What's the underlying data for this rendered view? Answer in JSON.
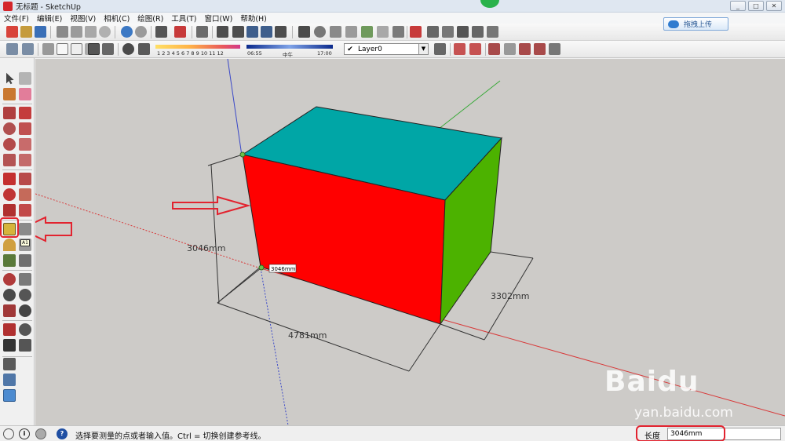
{
  "window": {
    "title": "无标题 - SketchUp",
    "controls": [
      "_",
      "□",
      "✕"
    ]
  },
  "menu": [
    "文件(F)",
    "编辑(E)",
    "视图(V)",
    "相机(C)",
    "绘图(R)",
    "工具(T)",
    "窗口(W)",
    "帮助(H)"
  ],
  "upload": {
    "label": "拖拽上传"
  },
  "shadow_settings": {
    "scale_ticks": "1 2 3 4 5 6 7 8 9 10 11 12",
    "time_start": "06:55",
    "time_mid": "中午",
    "time_end": "17:00"
  },
  "layer": {
    "check": "✔",
    "name": "Layer0",
    "arrow": "▼"
  },
  "tooltip": {
    "text": "A1"
  },
  "model": {
    "height_dim": "3046mm",
    "width_dim": "4781mm",
    "depth_dim": "3302mm",
    "cursor_readout": "3046mm",
    "top_color": "#00a6a6",
    "front_color": "#ff0000",
    "side_color": "#4cb200"
  },
  "annotation": {
    "color": "#e2232f"
  },
  "status": {
    "icons": [
      "i",
      "?"
    ],
    "hint": "选择要测量的点或者输入值。Ctrl = 切换创建参考线。",
    "vcb_label": "长度",
    "vcb_value": "3046mm"
  },
  "watermark": {
    "logo": "Baidu",
    "url": "yan.baidu.com"
  }
}
